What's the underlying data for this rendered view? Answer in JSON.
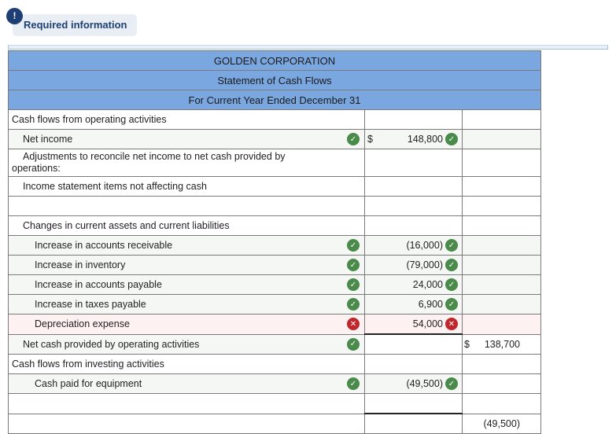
{
  "required_info": {
    "badge": "!",
    "label": "Required information"
  },
  "statement": {
    "company": "GOLDEN CORPORATION",
    "title": "Statement of Cash Flows",
    "period": "For Current Year Ended December 31"
  },
  "rows": [
    {
      "label": "Cash flows from operating activities"
    },
    {
      "label": "Net income",
      "label_status": "correct",
      "currency": "$",
      "mid": "148,800",
      "mid_status": "correct"
    },
    {
      "label": "Adjustments to reconcile net income to net cash provided by",
      "label_cont": "operations:"
    },
    {
      "label": "Income statement items not affecting cash"
    },
    {
      "label": ""
    },
    {
      "label": "Changes in current assets and current liabilities"
    },
    {
      "label": "Increase in accounts receivable",
      "label_status": "correct",
      "mid": "(16,000)",
      "mid_status": "correct"
    },
    {
      "label": "Increase in inventory",
      "label_status": "correct",
      "mid": "(79,000)",
      "mid_status": "correct"
    },
    {
      "label": "Increase in accounts payable",
      "label_status": "correct",
      "mid": "24,000",
      "mid_status": "correct"
    },
    {
      "label": "Increase in taxes payable",
      "label_status": "correct",
      "mid": "6,900",
      "mid_status": "correct"
    },
    {
      "label": "Depreciation expense",
      "label_status": "incorrect",
      "mid": "54,000",
      "mid_status": "incorrect"
    },
    {
      "label": "Net cash provided by operating activities",
      "label_status": "correct",
      "right_currency": "$",
      "right": "138,700"
    },
    {
      "label": "Cash flows from investing activities"
    },
    {
      "label": "Cash paid for equipment",
      "label_status": "correct",
      "mid": "(49,500)",
      "mid_status": "correct"
    },
    {
      "label": ""
    },
    {
      "label": "",
      "right": "(49,500)"
    }
  ],
  "icons": {
    "correct": "check-circle-icon",
    "incorrect": "x-circle-icon"
  },
  "colors": {
    "header_bg": "#7aa7e0",
    "correct": "#4a8a4a",
    "incorrect": "#c0272d",
    "badge": "#1d3f73"
  }
}
